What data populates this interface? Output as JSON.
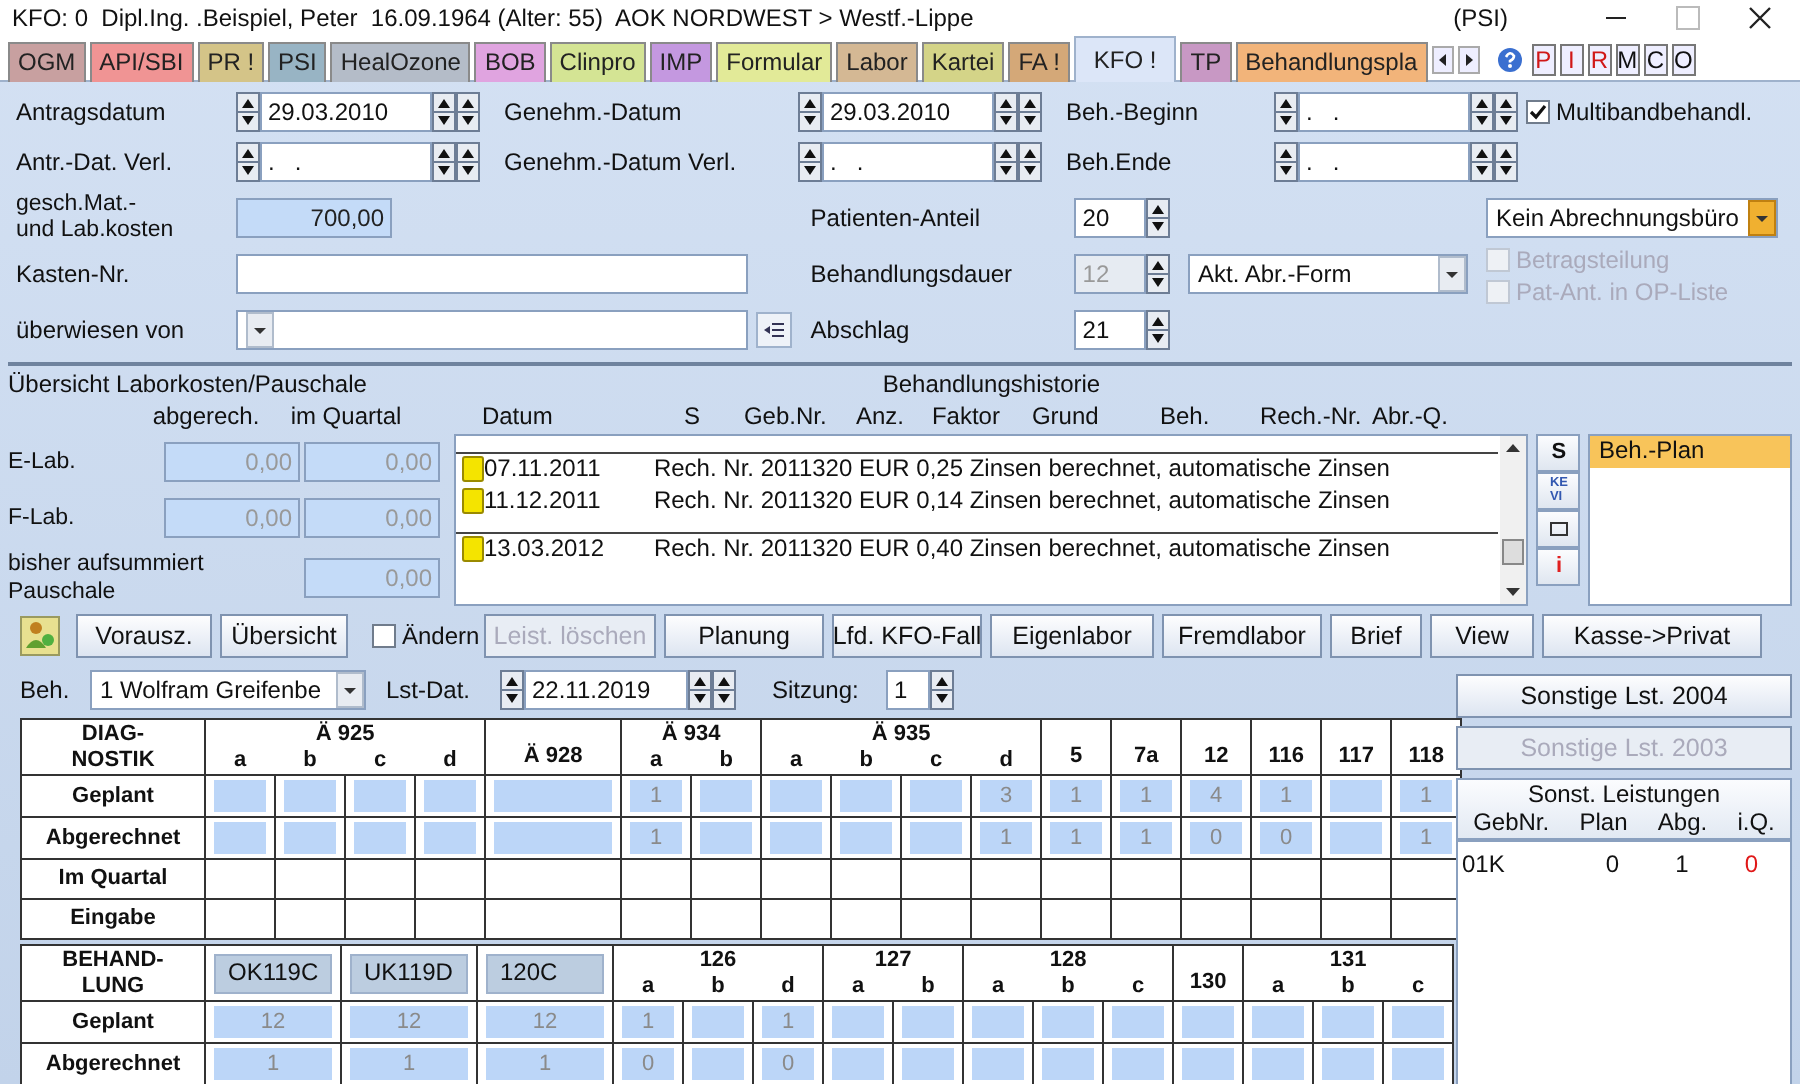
{
  "title_bar": {
    "title": "KFO: 0  Dipl.Ing. .Beispiel, Peter  16.09.1964 (Alter: 55)  AOK NORDWEST > Westf.-Lippe",
    "context": "(PSI)"
  },
  "tabs": [
    {
      "label": "OGM",
      "color": "#c8a0a0",
      "selected": false
    },
    {
      "label": "API/SBI",
      "color": "#f09494",
      "selected": false
    },
    {
      "label": "PR !",
      "color": "#d4c488",
      "selected": false
    },
    {
      "label": "PSI",
      "color": "#98b4c4",
      "selected": false
    },
    {
      "label": "HealOzone",
      "color": "#b4bcc8",
      "selected": false
    },
    {
      "label": "BOB",
      "color": "#e0a4e0",
      "selected": false
    },
    {
      "label": "Clinpro",
      "color": "#d4e494",
      "selected": false
    },
    {
      "label": "IMP",
      "color": "#c498e0",
      "selected": false
    },
    {
      "label": "Formular",
      "color": "#e2ea98",
      "selected": false
    },
    {
      "label": "Labor",
      "color": "#d4b894",
      "selected": false
    },
    {
      "label": "Kartei",
      "color": "#d4d488",
      "selected": false
    },
    {
      "label": "FA !",
      "color": "#d4a878",
      "selected": false
    },
    {
      "label": "KFO !",
      "color": "#dce6f8",
      "selected": true
    },
    {
      "label": "TP",
      "color": "#c898c4",
      "selected": false
    },
    {
      "label": "Behandlungspla",
      "color": "#f2b47a",
      "selected": false
    }
  ],
  "quick_buttons": [
    {
      "label": "P",
      "color": "#d01818"
    },
    {
      "label": "I",
      "color": "#d01818"
    },
    {
      "label": "R",
      "color": "#d01818"
    },
    {
      "label": "M",
      "color": "#101010"
    },
    {
      "label": "C",
      "color": "#101010"
    },
    {
      "label": "O",
      "color": "#101010"
    }
  ],
  "dates": [
    {
      "label": "Antragsdatum",
      "value": "29.03.2010"
    },
    {
      "label": "Genehm.-Datum",
      "value": "29.03.2010"
    },
    {
      "label": "Beh.-Beginn",
      "value": ".   ."
    },
    {
      "label": "Antr.-Dat. Verl.",
      "value": ".   ."
    },
    {
      "label": "Genehm.-Datum Verl.",
      "value": ".   ."
    },
    {
      "label": "Beh.Ende",
      "value": ".   ."
    }
  ],
  "multiband": {
    "label": "Multibandbehandl.",
    "checked": true
  },
  "costs": {
    "label": "gesch.Mat.-\nund Lab.kosten",
    "value": "700,00"
  },
  "kasten": {
    "label": "Kasten-Nr."
  },
  "referrer": {
    "label": "überwiesen von"
  },
  "number_fields": [
    {
      "label": "Patienten-Anteil",
      "value": "20",
      "disabled": false
    },
    {
      "label": "Behandlungsdauer",
      "value": "12",
      "disabled": true
    },
    {
      "label": "Abschlag",
      "value": "21",
      "disabled": false
    }
  ],
  "billing_form": {
    "value": "Akt. Abr.-Form"
  },
  "billing_office": {
    "value": "Kein Abrechnungsbüro"
  },
  "options": [
    {
      "label": "Betragsteilung",
      "checked": false,
      "disabled": true
    },
    {
      "label": "Pat-Ant. in OP-Liste",
      "checked": false,
      "disabled": true
    }
  ],
  "lab_costs": {
    "title": "Übersicht Laborkosten/Pauschale",
    "columns": [
      "abgerech.",
      "im Quartal"
    ],
    "rows": [
      {
        "label": "E-Lab.",
        "billed": "0,00",
        "quarter": "0,00"
      },
      {
        "label": "F-Lab.",
        "billed": "0,00",
        "quarter": "0,00"
      },
      {
        "label": "bisher aufsummiert\nPauschale",
        "quarter": "0,00"
      }
    ]
  },
  "history": {
    "title": "Behandlungshistorie",
    "columns": [
      "Datum",
      "S",
      "Geb.Nr.",
      "Anz.",
      "Faktor",
      "Grund",
      "Beh.",
      "Rech.-Nr.",
      "Abr.-Q."
    ],
    "entries": [
      {
        "date": "07.11.2011",
        "text": "Rech. Nr. 2011320 EUR 0,25 Zinsen berechnet, automatische Zinsen",
        "group_start": true
      },
      {
        "date": "11.12.2011",
        "text": "Rech. Nr. 2011320 EUR 0,14 Zinsen berechnet, automatische Zinsen",
        "group_start": false
      },
      {
        "date": "13.03.2012",
        "text": "Rech. Nr. 2011320 EUR 0,40 Zinsen berechnet, automatische Zinsen",
        "group_start": true
      }
    ]
  },
  "history_tools": [
    {
      "kind": "text",
      "label": "S"
    },
    {
      "kind": "small",
      "label": "KE\nVI"
    },
    {
      "kind": "icon"
    },
    {
      "kind": "alert",
      "label": "i"
    }
  ],
  "plans": [
    {
      "label": "Beh.-Plan",
      "selected": true
    }
  ],
  "toolbar": [
    {
      "kind": "button",
      "label": "Vorausz.",
      "disabled": false
    },
    {
      "kind": "button",
      "label": "Übersicht",
      "disabled": false
    },
    {
      "kind": "checkbox",
      "label": "Ändern",
      "checked": false
    },
    {
      "kind": "button",
      "label": "Leist. löschen",
      "disabled": true
    },
    {
      "kind": "button",
      "label": "Planung",
      "disabled": false
    },
    {
      "kind": "button",
      "label": "Lfd. KFO-Fall",
      "disabled": false
    },
    {
      "kind": "button",
      "label": "Eigenlabor",
      "disabled": false
    },
    {
      "kind": "button",
      "label": "Fremdlabor",
      "disabled": false
    },
    {
      "kind": "button",
      "label": "Brief",
      "disabled": false
    },
    {
      "kind": "button",
      "label": "View",
      "disabled": false
    },
    {
      "kind": "button",
      "label": "Kasse->Privat",
      "disabled": false
    }
  ],
  "session": {
    "beh_label": "Beh.",
    "beh_value": "1 Wolfram Greifenbe",
    "date_label": "Lst-Dat.",
    "date_value": "22.11.2019",
    "sitzung_label": "Sitzung:",
    "sitzung_value": "1"
  },
  "diagnostik": {
    "title": "DIAG-\nNOSTIK",
    "groups": [
      {
        "label": "Ä 925",
        "subs": [
          {
            "label": "a"
          },
          {
            "label": "b"
          },
          {
            "label": "c"
          },
          {
            "label": "d"
          }
        ]
      },
      {
        "label": "Ä 928"
      },
      {
        "label": "Ä 934",
        "subs": [
          {
            "label": "a",
            "planned": "1",
            "billed": "1"
          },
          {
            "label": "b"
          }
        ]
      },
      {
        "label": "Ä 935",
        "subs": [
          {
            "label": "a"
          },
          {
            "label": "b"
          },
          {
            "label": "c"
          },
          {
            "label": "d",
            "planned": "3",
            "billed": "1"
          }
        ]
      },
      {
        "label": "5",
        "planned": "1",
        "billed": "1"
      },
      {
        "label": "7a",
        "planned": "1",
        "billed": "1"
      },
      {
        "label": "12",
        "planned": "4",
        "billed": "0"
      },
      {
        "label": "116",
        "planned": "1",
        "billed": "0"
      },
      {
        "label": "117"
      },
      {
        "label": "118",
        "planned": "1",
        "billed": "1"
      }
    ],
    "rows": [
      {
        "label": "Geplant",
        "kind": "planned"
      },
      {
        "label": "Abgerechnet",
        "kind": "billed"
      },
      {
        "label": "Im Quartal",
        "kind": "plain"
      },
      {
        "label": "Eingabe",
        "kind": "plain"
      }
    ]
  },
  "behandlung": {
    "title": "BEHAND-\nLUNG",
    "groups": [
      {
        "label": "OK119C",
        "kind": "code",
        "planned": "12",
        "billed": "1"
      },
      {
        "label": "UK119D",
        "kind": "code",
        "planned": "12",
        "billed": "1"
      },
      {
        "label": "120C",
        "kind": "code",
        "planned": "12",
        "billed": "1"
      },
      {
        "label": "126",
        "subs": [
          {
            "label": "a",
            "planned": "1",
            "billed": "0"
          },
          {
            "label": "b"
          },
          {
            "label": "d",
            "planned": "1",
            "billed": "0"
          }
        ]
      },
      {
        "label": "127",
        "subs": [
          {
            "label": "a"
          },
          {
            "label": "b"
          }
        ]
      },
      {
        "label": "128",
        "subs": [
          {
            "label": "a"
          },
          {
            "label": "b"
          },
          {
            "label": "c"
          }
        ]
      },
      {
        "label": "130"
      },
      {
        "label": "131",
        "subs": [
          {
            "label": "a"
          },
          {
            "label": "b"
          },
          {
            "label": "c"
          }
        ]
      }
    ],
    "rows": [
      {
        "label": "Geplant",
        "kind": "planned"
      },
      {
        "label": "Abgerechnet",
        "kind": "billed"
      }
    ]
  },
  "other_services": {
    "buttons": [
      {
        "label": "Sonstige Lst. 2004",
        "disabled": false
      },
      {
        "label": "Sonstige Lst. 2003",
        "disabled": true
      }
    ],
    "title": "Sonst. Leistungen",
    "columns": [
      "GebNr.",
      "Plan",
      "Abg.",
      "i.Q."
    ],
    "rows": [
      {
        "values": [
          "01K",
          "0",
          "1",
          "0"
        ],
        "warning": true
      }
    ]
  }
}
